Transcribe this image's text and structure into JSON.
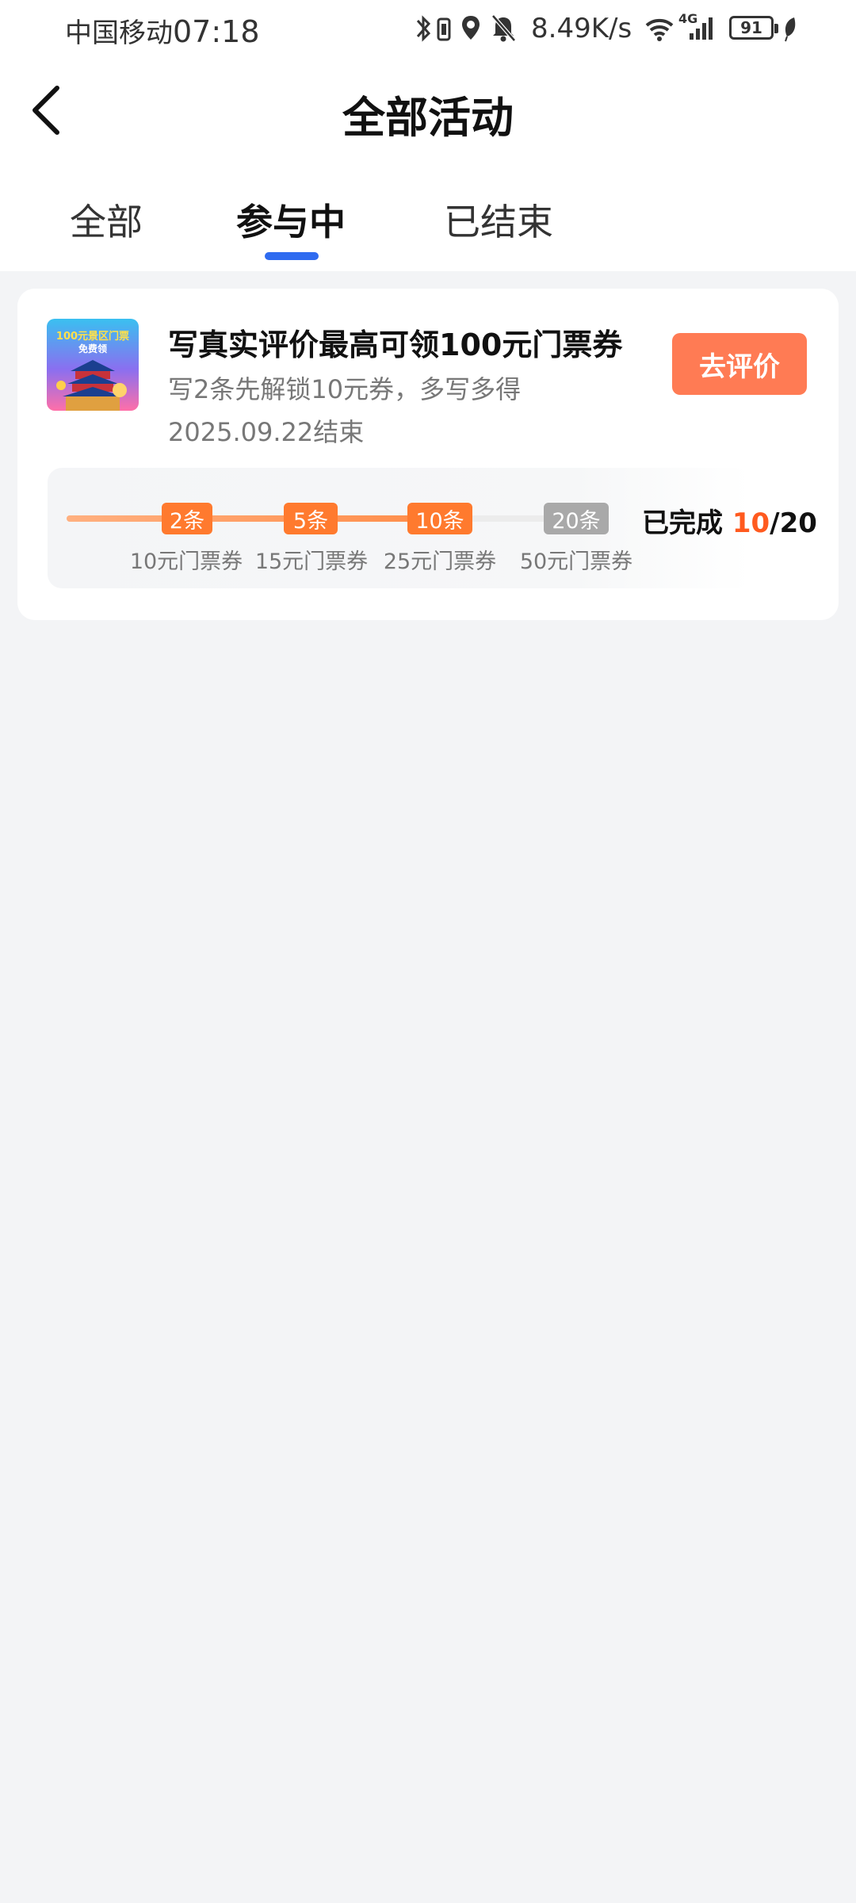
{
  "status_bar": {
    "carrier": "中国移动",
    "time": "07:18",
    "net_speed": "8.49K/s",
    "network_type": "4G",
    "battery": "91",
    "icons": [
      "bluetooth-icon",
      "vibrate-icon",
      "location-icon",
      "bell-off-icon",
      "wifi-icon",
      "signal-icon",
      "leaf-icon"
    ]
  },
  "header": {
    "title": "全部活动",
    "back_icon": "chevron-left-icon"
  },
  "tabs": [
    {
      "label": "全部",
      "active": false
    },
    {
      "label": "参与中",
      "active": true
    },
    {
      "label": "已结束",
      "active": false
    }
  ],
  "accent_color": "#2f6bf0",
  "activity": {
    "title": "写真实评价最高可领100元门票券",
    "subtitle": "写2条先解锁10元券，多写多得",
    "end_date": "2025.09.22结束",
    "button_label": "去评价",
    "button_color": "#ff7b54",
    "thumbnail": {
      "text_line1": "100元景区门票",
      "text_line2": "免费领"
    },
    "milestones": [
      {
        "label": "2条",
        "reward": "10元门票券",
        "reached": true
      },
      {
        "label": "5条",
        "reward": "15元门票券",
        "reached": true
      },
      {
        "label": "10条",
        "reward": "25元门票券",
        "reached": true
      },
      {
        "label": "20条",
        "reward": "50元门票券",
        "reached": false
      }
    ],
    "progress": {
      "prefix": "已完成 ",
      "done": "10",
      "separator": "/",
      "total": "20"
    },
    "progress_color": "#ff7a2e",
    "pending_color": "#a9a9a9"
  }
}
